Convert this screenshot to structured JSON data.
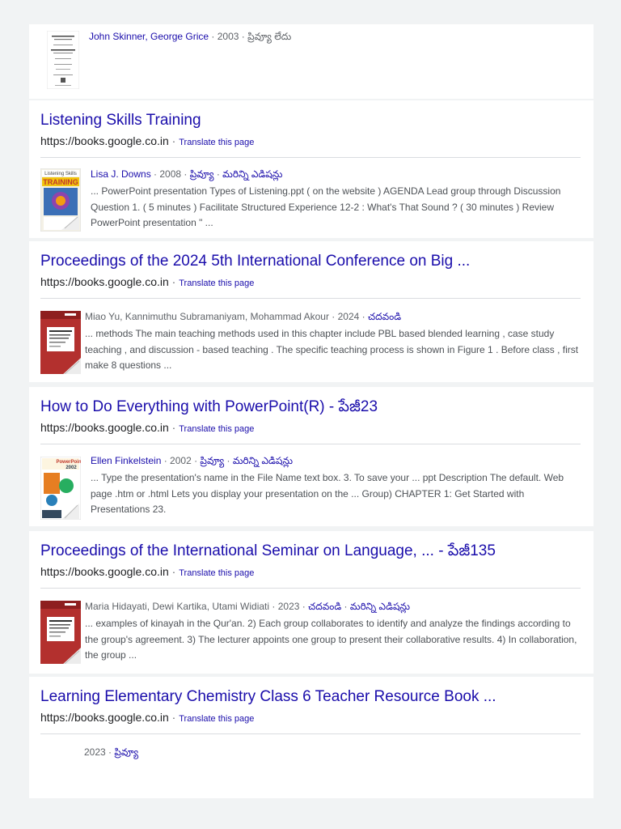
{
  "results": [
    {
      "title": "",
      "url": "",
      "translate": "",
      "author": "John Skinner, George Grice",
      "author_link": true,
      "year": "2003",
      "links": [
        "ప్రివ్యూ లేదు"
      ],
      "snippet": "",
      "thumb_style": "text-cover"
    },
    {
      "title": "Listening Skills Training",
      "url": "https://books.google.co.in",
      "translate": "Translate this page",
      "author": "Lisa J. Downs",
      "author_link": true,
      "year": "2008",
      "links": [
        "ప్రివ్యూ",
        "మరిన్ని ఎడిషన్లు"
      ],
      "snippet": "... PowerPoint presentation Types of Listening.ppt ( on the website ) AGENDA Lead group through Discussion Question 1. ( 5 minutes ) Facilitate Structured Experience 12-2 : What's That Sound ? ( 30 minutes ) Review PowerPoint presentation \" ...",
      "thumb_style": "training"
    },
    {
      "title": "Proceedings of the 2024 5th International Conference on Big ...",
      "url": "https://books.google.co.in",
      "translate": "Translate this page",
      "author": "Miao Yu, Kannimuthu Subramaniyam, Mohammad Akour",
      "author_link": false,
      "year": "2024",
      "links": [
        "చదవండి"
      ],
      "snippet": "... methods The main teaching methods used in this chapter include PBL based blended learning , case study teaching , and discussion - based teaching . The specific teaching process is shown in Figure 1 . Before class , first make 8 questions ...",
      "thumb_style": "red"
    },
    {
      "title": "How to Do Everything with PowerPoint(R) - పేజీ23",
      "url": "https://books.google.co.in",
      "translate": "Translate this page",
      "author": "Ellen Finkelstein",
      "author_link": true,
      "year": "2002",
      "links": [
        "ప్రివ్యూ",
        "మరిన్ని ఎడిషన్లు"
      ],
      "snippet": "... Type the presentation's name in the File Name text box. 3. To save your ... ppt Description The default. Web page .htm or .html Lets you display your presentation on the ... Group) CHAPTER 1: Get Started with Presentations 23.",
      "thumb_style": "powerpoint"
    },
    {
      "title": "Proceedings of the International Seminar on Language, ... - పేజీ135",
      "url": "https://books.google.co.in",
      "translate": "Translate this page",
      "author": "Maria Hidayati, Dewi Kartika, Utami Widiati",
      "author_link": false,
      "year": "2023",
      "links": [
        "చదవండి",
        "మరిన్ని ఎడిషన్లు"
      ],
      "snippet": "... examples of kinayah in the Qur'an. 2) Each group collaborates to identify and analyze the findings according to the group's agreement. 3) The lecturer appoints one group to present their collaborative results. 4) In collaboration, the group ...",
      "thumb_style": "red"
    },
    {
      "title": "Learning Elementary Chemistry Class 6 Teacher Resource Book ...",
      "url": "https://books.google.co.in",
      "translate": "Translate this page",
      "author": "",
      "author_link": false,
      "year": "2023",
      "links": [
        "ప్రివ్యూ"
      ],
      "snippet": "",
      "thumb_style": "none"
    }
  ],
  "separator": " · ",
  "colors": {
    "link": "#1a0dab",
    "text": "#202124",
    "muted": "#5f6368",
    "background": "#f1f3f4",
    "card": "#ffffff"
  }
}
